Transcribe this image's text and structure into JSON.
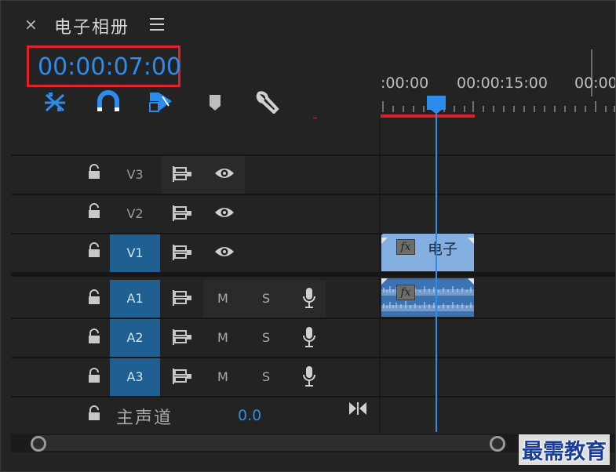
{
  "panel": {
    "close_glyph": "×",
    "title": "电子相册",
    "menu_icon": "hamburger-menu-icon"
  },
  "timecode": "00:00:07:00",
  "toolbar": {
    "icons": [
      "snap-nest-icon",
      "magnet-snap-icon",
      "linked-selection-icon",
      "add-marker-icon",
      "wrench-settings-icon"
    ]
  },
  "ruler": {
    "labels": [
      ":00:00",
      "00:00:15:00",
      "00:00"
    ]
  },
  "tracks": {
    "video": [
      {
        "name": "V3",
        "active": false
      },
      {
        "name": "V2",
        "active": false
      },
      {
        "name": "V1",
        "active": true
      }
    ],
    "audio": [
      {
        "name": "A1",
        "active": true,
        "mute": "M",
        "solo": "S"
      },
      {
        "name": "A2",
        "active": true,
        "mute": "M",
        "solo": "S"
      },
      {
        "name": "A3",
        "active": true,
        "mute": "M",
        "solo": "S"
      }
    ],
    "master": {
      "label": "主声道",
      "value": "0.0"
    }
  },
  "clips": {
    "video_label": "电子",
    "fx_label": "fx"
  },
  "watermark": "最需教育",
  "colors": {
    "accent": "#2d8ceb",
    "highlight_red": "#e0202a",
    "track_on": "#1f5f91",
    "video_clip": "#84afe0",
    "audio_clip": "#3d73b3"
  }
}
